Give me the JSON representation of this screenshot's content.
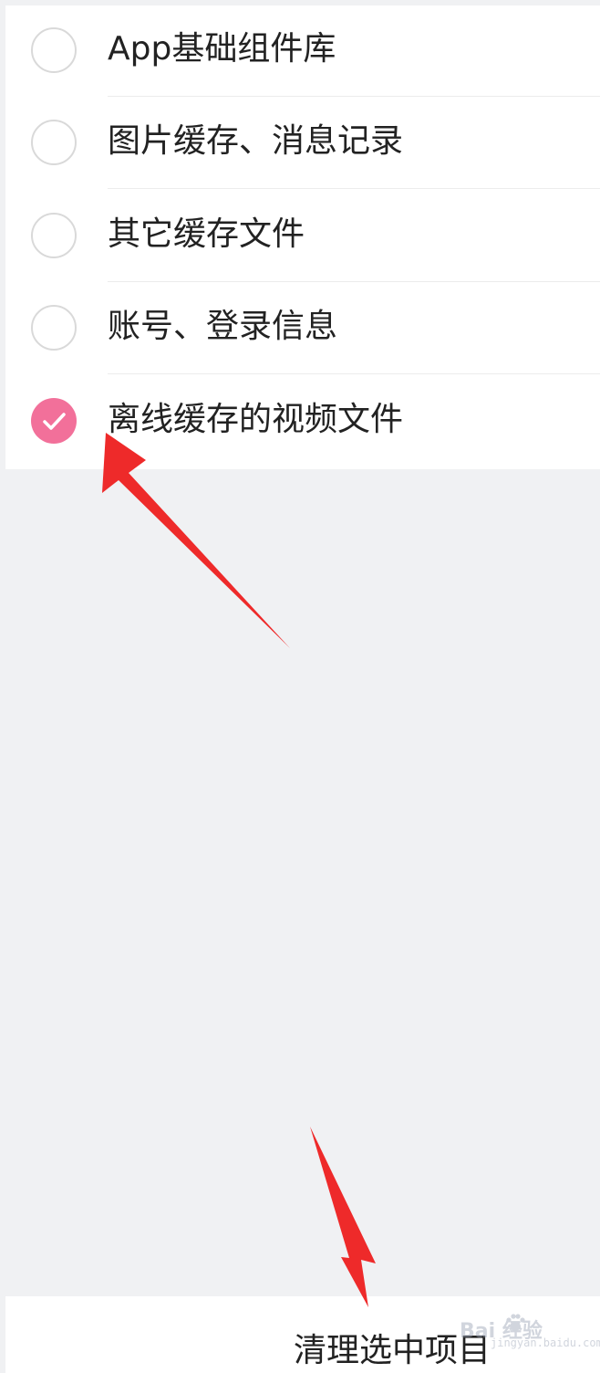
{
  "options": [
    {
      "label": "App基础组件库",
      "checked": false
    },
    {
      "label": "图片缓存、消息记录",
      "checked": false
    },
    {
      "label": "其它缓存文件",
      "checked": false
    },
    {
      "label": "账号、登录信息",
      "checked": false
    },
    {
      "label": "离线缓存的视频文件",
      "checked": true
    }
  ],
  "footer": {
    "clear_label": "清理选中项目"
  },
  "watermark": {
    "brand": "Bai 经验",
    "site": "jingyan.baidu.com"
  },
  "colors": {
    "accent": "#f2709a",
    "annotation_arrow": "#ee2a2a",
    "page_background": "#f0f1f3",
    "list_background": "#ffffff"
  }
}
